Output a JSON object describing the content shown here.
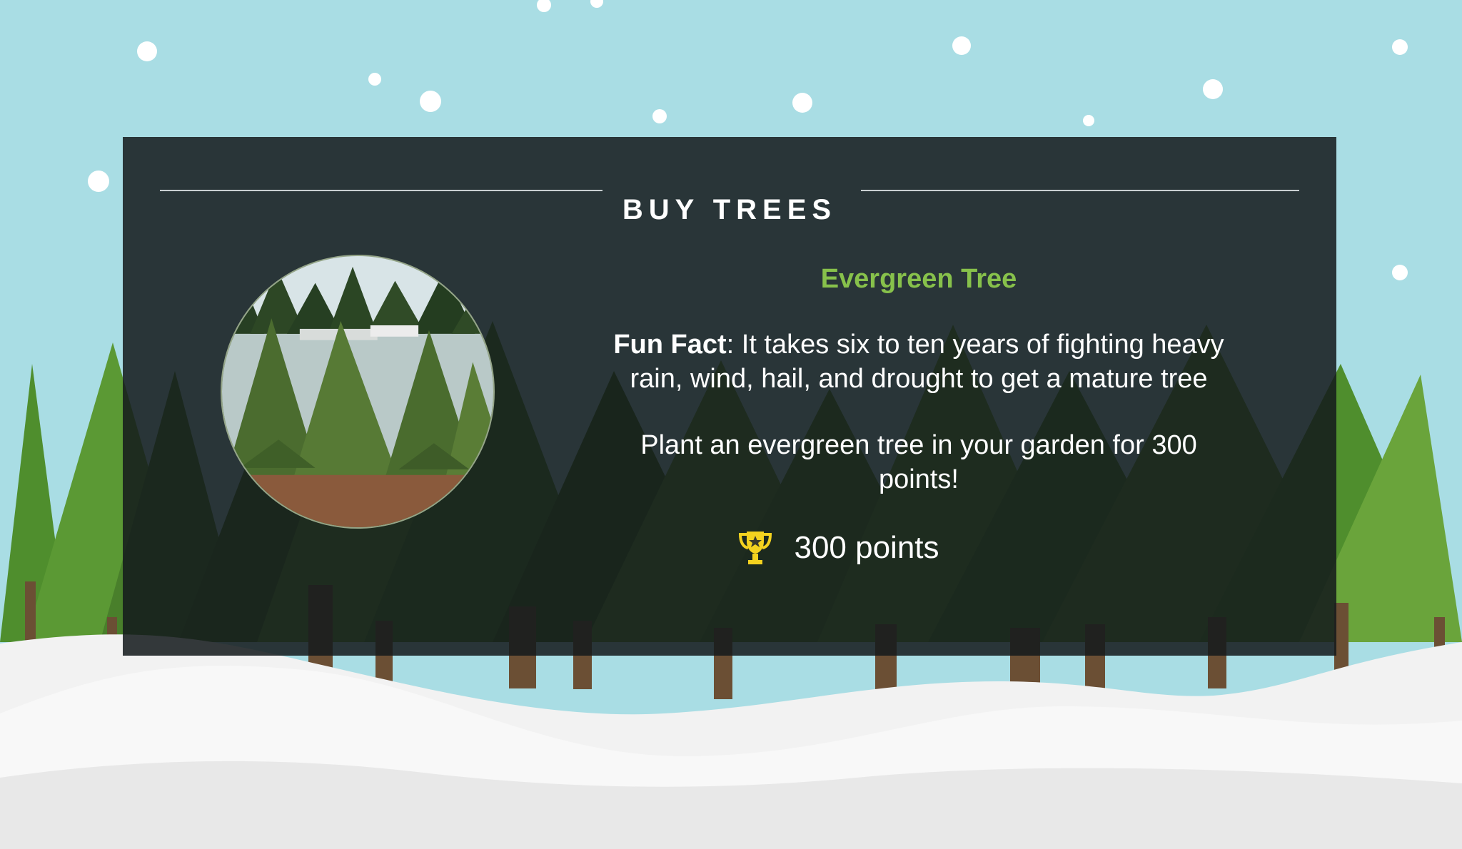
{
  "panel": {
    "title": "BUY TREES",
    "item": {
      "name": "Evergreen Tree",
      "fact_label": "Fun Fact",
      "fact_text": ": It takes six to ten years of fighting heavy rain, wind, hail, and drought to get a mature tree",
      "offer_text": "Plant an evergreen tree in your garden for 300 points!",
      "points_text": "300 points",
      "photo": "evergreen-tree-photo"
    },
    "icons": {
      "points": "trophy-icon"
    }
  },
  "colors": {
    "sky": "#a9dde4",
    "panel_bg": "#141a1c",
    "title_green": "#87c14b",
    "trophy": "#f4d21f"
  }
}
